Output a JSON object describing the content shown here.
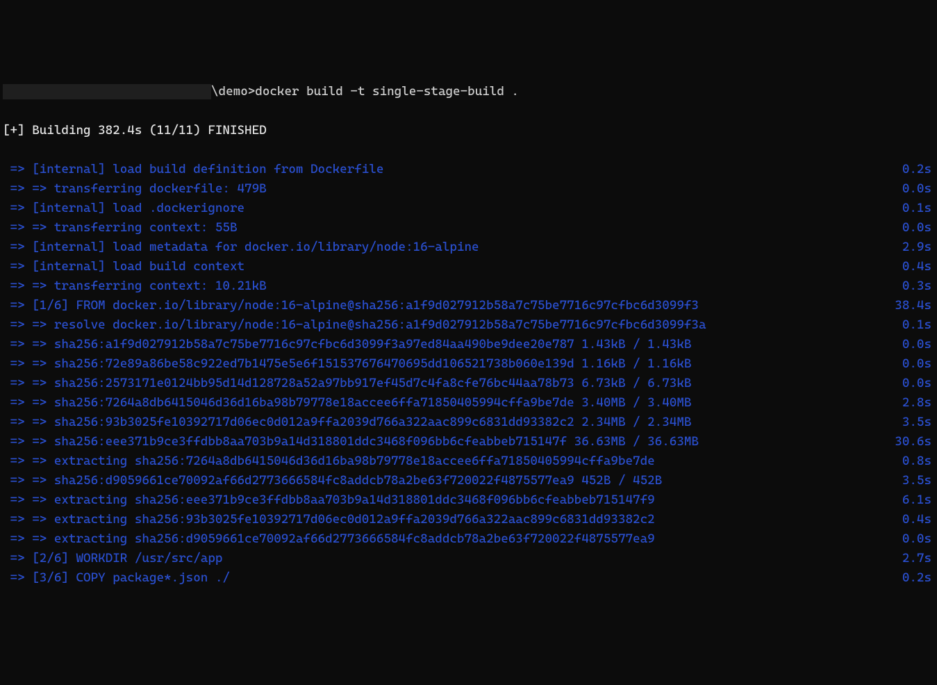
{
  "prompt_suffix": "\\demo>",
  "command": "docker build -t single-stage-build .",
  "status_line": "[+] Building 382.4s (11/11) FINISHED",
  "lines": [
    {
      "text": "=> [internal] load build definition from Dockerfile",
      "time": "0.2s"
    },
    {
      "text": "=> => transferring dockerfile: 479B",
      "time": "0.0s"
    },
    {
      "text": "=> [internal] load .dockerignore",
      "time": "0.1s"
    },
    {
      "text": "=> => transferring context: 55B",
      "time": "0.0s"
    },
    {
      "text": "=> [internal] load metadata for docker.io/library/node:16-alpine",
      "time": "2.9s"
    },
    {
      "text": "=> [internal] load build context",
      "time": "0.4s"
    },
    {
      "text": "=> => transferring context: 10.21kB",
      "time": "0.3s"
    },
    {
      "text": "=> [1/6] FROM docker.io/library/node:16-alpine@sha256:a1f9d027912b58a7c75be7716c97cfbc6d3099f3",
      "time": "38.4s"
    },
    {
      "text": "=> => resolve docker.io/library/node:16-alpine@sha256:a1f9d027912b58a7c75be7716c97cfbc6d3099f3a",
      "time": "0.1s"
    },
    {
      "text": "=> => sha256:a1f9d027912b58a7c75be7716c97cfbc6d3099f3a97ed84aa490be9dee20e787 1.43kB / 1.43kB",
      "time": "0.0s"
    },
    {
      "text": "=> => sha256:72e89a86be58c922ed7b1475e5e6f151537676470695dd106521738b060e139d 1.16kB / 1.16kB",
      "time": "0.0s"
    },
    {
      "text": "=> => sha256:2573171e0124bb95d14d128728a52a97bb917ef45d7c4fa8cfe76bc44aa78b73 6.73kB / 6.73kB",
      "time": "0.0s"
    },
    {
      "text": "=> => sha256:7264a8db6415046d36d16ba98b79778e18accee6ffa71850405994cffa9be7de 3.40MB / 3.40MB",
      "time": "2.8s"
    },
    {
      "text": "=> => sha256:93b3025fe10392717d06ec0d012a9ffa2039d766a322aac899c6831dd93382c2 2.34MB / 2.34MB",
      "time": "3.5s"
    },
    {
      "text": "=> => sha256:eee371b9ce3ffdbb8aa703b9a14d318801ddc3468f096bb6cfeabbeb715147f 36.63MB / 36.63MB",
      "time": "30.6s"
    },
    {
      "text": "=> => extracting sha256:7264a8db6415046d36d16ba98b79778e18accee6ffa71850405994cffa9be7de",
      "time": "0.8s"
    },
    {
      "text": "=> => sha256:d9059661ce70092af66d2773666584fc8addcb78a2be63f720022f4875577ea9 452B / 452B",
      "time": "3.5s"
    },
    {
      "text": "=> => extracting sha256:eee371b9ce3ffdbb8aa703b9a14d318801ddc3468f096bb6cfeabbeb715147f9",
      "time": "6.1s"
    },
    {
      "text": "=> => extracting sha256:93b3025fe10392717d06ec0d012a9ffa2039d766a322aac899c6831dd93382c2",
      "time": "0.4s"
    },
    {
      "text": "=> => extracting sha256:d9059661ce70092af66d2773666584fc8addcb78a2be63f720022f4875577ea9",
      "time": "0.0s"
    },
    {
      "text": "=> [2/6] WORKDIR /usr/src/app",
      "time": "2.7s"
    },
    {
      "text": "=> [3/6] COPY package*.json ./",
      "time": "0.2s"
    }
  ]
}
